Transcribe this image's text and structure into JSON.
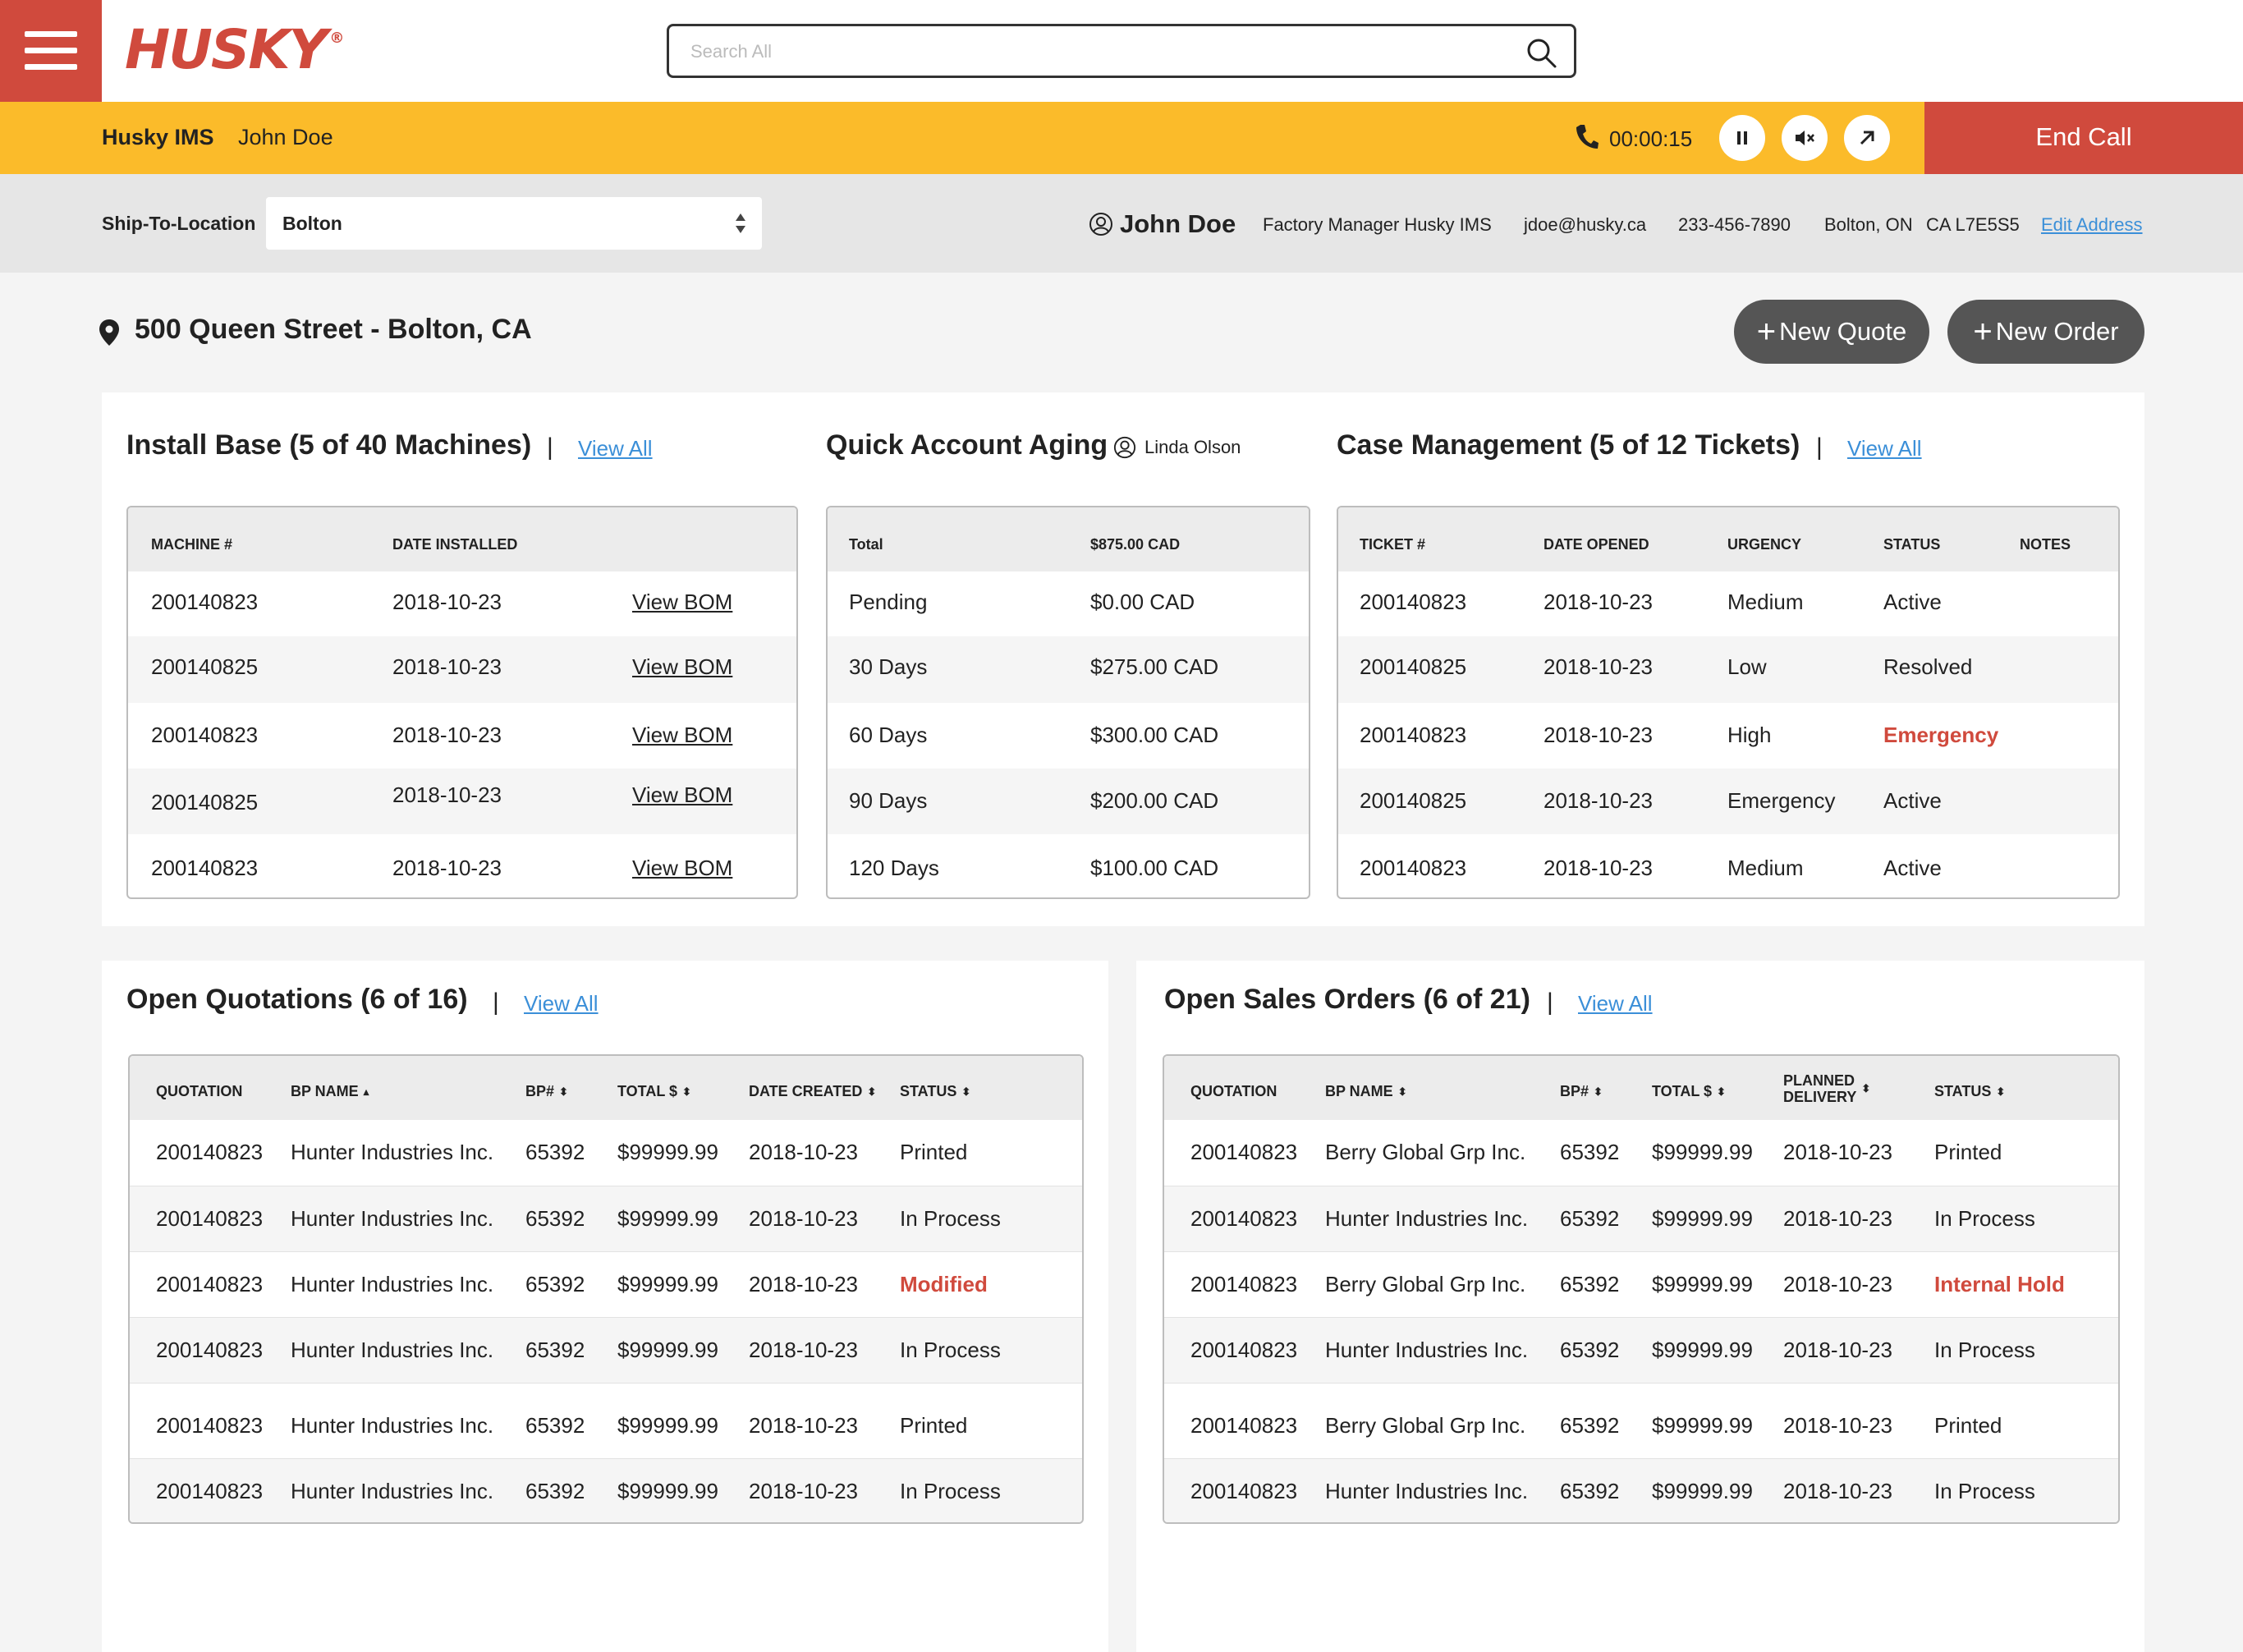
{
  "header": {
    "logo_text": "HUSKY",
    "logo_mark": "®",
    "search_placeholder": "Search All",
    "brand_color": "#d04a3d"
  },
  "call": {
    "org": "Husky IMS",
    "caller": "John Doe",
    "timer": "00:00:15",
    "end_label": "End Call",
    "bar_color": "#fbbb2a"
  },
  "location": {
    "label": "Ship-To-Location",
    "selected": "Bolton",
    "contact_name": "John Doe",
    "contact_title": "Factory Manager Husky IMS",
    "email": "jdoe@husky.ca",
    "phone": "233-456-7890",
    "city": "Bolton, ON",
    "postal": "CA L7E5S5",
    "edit_label": "Edit Address"
  },
  "address": {
    "text": "500 Queen Street - Bolton, CA",
    "new_quote": "New Quote",
    "new_order": "New Order"
  },
  "install_base": {
    "title": "Install Base (5 of 40 Machines)",
    "view_all": "View All",
    "headers": [
      "MACHINE #",
      "DATE INSTALLED"
    ],
    "rows": [
      {
        "machine": "200140823",
        "date": "2018-10-23",
        "link": "View BOM"
      },
      {
        "machine": "200140825",
        "date": "2018-10-23",
        "link": "View BOM"
      },
      {
        "machine": "200140823",
        "date": "2018-10-23",
        "link": "View BOM"
      },
      {
        "machine": "200140825",
        "date": "2018-10-23",
        "link": "View BOM"
      },
      {
        "machine": "200140823",
        "date": "2018-10-23",
        "link": "View BOM"
      }
    ]
  },
  "aging": {
    "title": "Quick Account Aging",
    "user": "Linda Olson",
    "headers": [
      "Total",
      "$875.00 CAD"
    ],
    "rows": [
      {
        "period": "Pending",
        "amount": "$0.00 CAD"
      },
      {
        "period": "30 Days",
        "amount": "$275.00 CAD"
      },
      {
        "period": "60 Days",
        "amount": "$300.00 CAD"
      },
      {
        "period": "90 Days",
        "amount": "$200.00 CAD"
      },
      {
        "period": "120 Days",
        "amount": "$100.00 CAD"
      }
    ]
  },
  "cases": {
    "title": "Case Management (5 of 12 Tickets)",
    "view_all": "View All",
    "headers": [
      "TICKET #",
      "DATE OPENED",
      "URGENCY",
      "STATUS",
      "NOTES"
    ],
    "rows": [
      {
        "ticket": "200140823",
        "date": "2018-10-23",
        "urgency": "Medium",
        "status": "Active"
      },
      {
        "ticket": "200140825",
        "date": "2018-10-23",
        "urgency": "Low",
        "status": "Resolved"
      },
      {
        "ticket": "200140823",
        "date": "2018-10-23",
        "urgency": "High",
        "status": "Emergency"
      },
      {
        "ticket": "200140825",
        "date": "2018-10-23",
        "urgency": "Emergency",
        "status": "Active"
      },
      {
        "ticket": "200140823",
        "date": "2018-10-23",
        "urgency": "Medium",
        "status": "Active"
      }
    ]
  },
  "quotations": {
    "title": "Open Quotations (6 of 16)",
    "view_all": "View All",
    "headers": [
      "QUOTATION",
      "BP NAME",
      "BP#",
      "TOTAL $",
      "DATE CREATED",
      "STATUS"
    ],
    "rows": [
      {
        "id": "200140823",
        "bp": "Hunter Industries Inc.",
        "bpn": "65392",
        "total": "$99999.99",
        "date": "2018-10-23",
        "status": "Printed"
      },
      {
        "id": "200140823",
        "bp": "Hunter Industries Inc.",
        "bpn": "65392",
        "total": "$99999.99",
        "date": "2018-10-23",
        "status": "In Process"
      },
      {
        "id": "200140823",
        "bp": "Hunter Industries Inc.",
        "bpn": "65392",
        "total": "$99999.99",
        "date": "2018-10-23",
        "status": "Modified"
      },
      {
        "id": "200140823",
        "bp": "Hunter Industries Inc.",
        "bpn": "65392",
        "total": "$99999.99",
        "date": "2018-10-23",
        "status": "In Process"
      },
      {
        "id": "200140823",
        "bp": "Hunter Industries Inc.",
        "bpn": "65392",
        "total": "$99999.99",
        "date": "2018-10-23",
        "status": "Printed"
      },
      {
        "id": "200140823",
        "bp": "Hunter Industries Inc.",
        "bpn": "65392",
        "total": "$99999.99",
        "date": "2018-10-23",
        "status": "In Process"
      }
    ]
  },
  "orders": {
    "title": "Open Sales Orders (6 of 21)",
    "view_all": "View All",
    "headers": [
      "QUOTATION",
      "BP NAME",
      "BP#",
      "TOTAL $",
      "PLANNED",
      "DELIVERY",
      "STATUS"
    ],
    "rows": [
      {
        "id": "200140823",
        "bp": "Berry Global Grp Inc.",
        "bpn": "65392",
        "total": "$99999.99",
        "date": "2018-10-23",
        "status": "Printed"
      },
      {
        "id": "200140823",
        "bp": "Hunter Industries Inc.",
        "bpn": "65392",
        "total": "$99999.99",
        "date": "2018-10-23",
        "status": "In Process"
      },
      {
        "id": "200140823",
        "bp": "Berry Global Grp Inc.",
        "bpn": "65392",
        "total": "$99999.99",
        "date": "2018-10-23",
        "status": "Internal Hold"
      },
      {
        "id": "200140823",
        "bp": "Hunter Industries Inc.",
        "bpn": "65392",
        "total": "$99999.99",
        "date": "2018-10-23",
        "status": "In Process"
      },
      {
        "id": "200140823",
        "bp": "Berry Global Grp Inc.",
        "bpn": "65392",
        "total": "$99999.99",
        "date": "2018-10-23",
        "status": "Printed"
      },
      {
        "id": "200140823",
        "bp": "Hunter Industries Inc.",
        "bpn": "65392",
        "total": "$99999.99",
        "date": "2018-10-23",
        "status": "In Process"
      }
    ]
  }
}
